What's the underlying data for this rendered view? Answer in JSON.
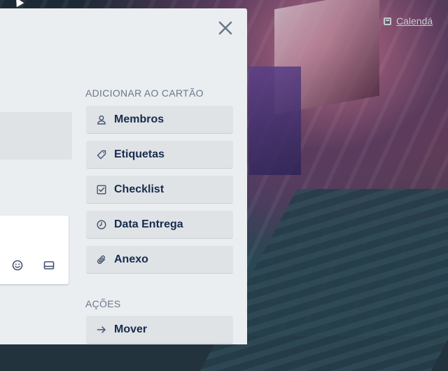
{
  "header": {
    "calendar_label": "Calendá"
  },
  "card_panel": {
    "add_to_card": {
      "title": "ADICIONAR AO CARTÃO",
      "buttons": [
        {
          "label": "Membros",
          "icon": "person-icon"
        },
        {
          "label": "Etiquetas",
          "icon": "tag-icon"
        },
        {
          "label": "Checklist",
          "icon": "checkbox-icon"
        },
        {
          "label": "Data Entrega",
          "icon": "clock-icon"
        },
        {
          "label": "Anexo",
          "icon": "paperclip-icon"
        }
      ]
    },
    "actions": {
      "title": "AÇÕES",
      "buttons": [
        {
          "label": "Mover",
          "icon": "arrow-right-icon"
        }
      ]
    }
  },
  "colors": {
    "panel_bg": "#ebeef0",
    "button_bg": "#dfe3e6",
    "button_text": "#172b4d",
    "section_title": "#6b778c",
    "icon": "#42526e"
  }
}
